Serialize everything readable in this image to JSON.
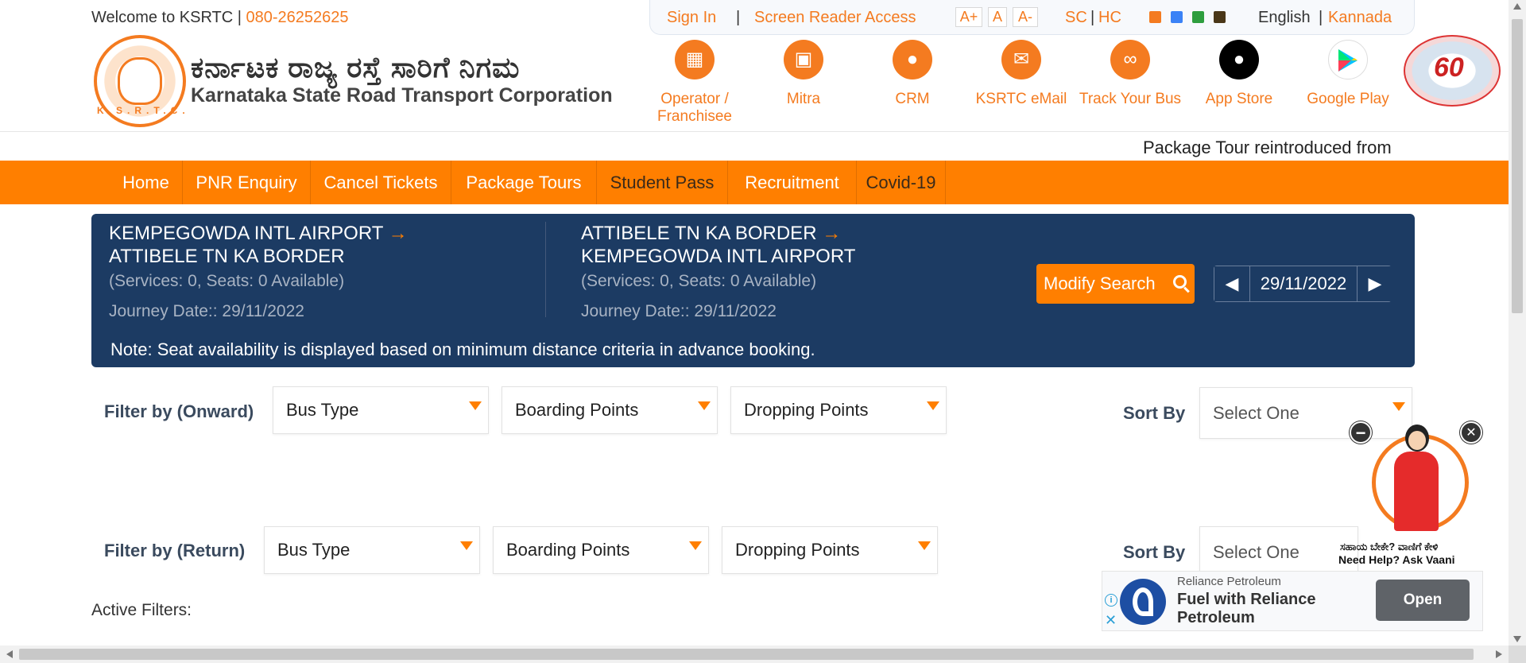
{
  "header": {
    "welcome_text": "Welcome to KSRTC | ",
    "phone": "080-26252625",
    "org_kannada": "ಕರ್ನಾಟಕ ರಾಜ್ಯ ರಸ್ತೆ ಸಾರಿಗೆ ನಿಗಮ",
    "org_english": "Karnataka State Road Transport Corporation",
    "logo_text": "K.S.R.T.C.",
    "anniversary_badge": "60"
  },
  "utility": {
    "sign_in": "Sign In",
    "sep": "|",
    "screen_reader": "Screen Reader Access",
    "font_plus": "A+",
    "font_normal": "A",
    "font_minus": "A-",
    "sc": "SC",
    "pipe": "|",
    "hc": "HC",
    "theme_colors": [
      "#f47b20",
      "#3b82f6",
      "#2e9e3e",
      "#4a3718"
    ],
    "lang_english": "English",
    "lang_kannada": "Kannada"
  },
  "quick_links": [
    {
      "label": "Operator / Franchisee",
      "icon": "operator-icon"
    },
    {
      "label": "Mitra",
      "icon": "bus-icon"
    },
    {
      "label": "CRM",
      "icon": "user-icon"
    },
    {
      "label": "KSRTC eMail",
      "icon": "mail-icon"
    },
    {
      "label": "Track Your Bus",
      "icon": "route-icon"
    },
    {
      "label": "App Store",
      "icon": "apple-icon"
    },
    {
      "label": "Google Play",
      "icon": "google-play-icon"
    }
  ],
  "ticker": "Package Tour reintroduced from",
  "nav": [
    {
      "label": "Home"
    },
    {
      "label": "PNR Enquiry"
    },
    {
      "label": "Cancel Tickets"
    },
    {
      "label": "Package Tours"
    },
    {
      "label": "Student Pass"
    },
    {
      "label": "Recruitment"
    },
    {
      "label": "Covid-19"
    }
  ],
  "onward": {
    "from": "KEMPEGOWDA INTL AIRPORT",
    "arrow": "→",
    "to": "ATTIBELE TN KA BORDER",
    "services": "(Services: 0, Seats: 0 Available)",
    "journey_date": "Journey Date:: 29/11/2022"
  },
  "return": {
    "from": "ATTIBELE TN KA BORDER",
    "arrow": "→",
    "to": "KEMPEGOWDA INTL AIRPORT",
    "services": "(Services: 0, Seats: 0 Available)",
    "journey_date": "Journey Date:: 29/11/2022"
  },
  "search": {
    "modify_label": "Modify Search",
    "date": "29/11/2022"
  },
  "note": "Note: Seat availability is displayed based on minimum distance criteria in advance booking.",
  "filters": {
    "onward_label": "Filter by (Onward)",
    "return_label": "Filter by (Return)",
    "bus_type": "Bus Type",
    "boarding": "Boarding Points",
    "dropping": "Dropping Points",
    "sort_label": "Sort By",
    "sort_value": "Select One",
    "active_filters": "Active Filters:"
  },
  "vaani": {
    "kannada": "ಸಹಾಯ ಬೇಕೇ? ವಾಣಿಗೆ ಕೇಳಿ",
    "english": "Need Help? Ask Vaani",
    "minimize": "−",
    "close": "✕"
  },
  "ad": {
    "advertiser": "Reliance Petroleum",
    "headline": "Fuel with Reliance Petroleum",
    "cta": "Open",
    "info": "i",
    "close": "✕"
  }
}
